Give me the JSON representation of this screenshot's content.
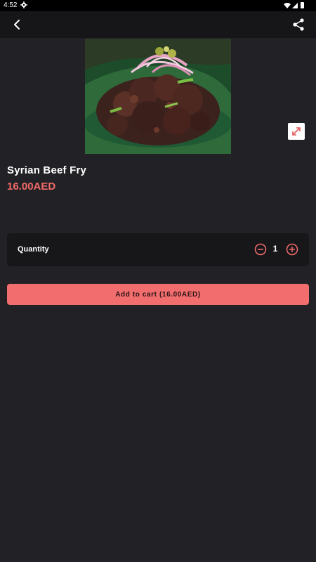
{
  "status_bar": {
    "time": "4:52",
    "icons": [
      "settings-gear-icon",
      "wifi-icon",
      "signal-icon",
      "battery-icon"
    ]
  },
  "app_bar": {
    "back_icon": "chevron-left-icon",
    "share_icon": "share-icon"
  },
  "product": {
    "image_icon": "food-photo",
    "expand_icon": "expand-arrows-icon",
    "name": "Syrian Beef Fry",
    "price": "16.00AED"
  },
  "quantity": {
    "label": "Quantity",
    "value": "1",
    "minus_icon": "minus-circle-icon",
    "plus_icon": "plus-circle-icon"
  },
  "cart": {
    "button_label": "Add to cart (16.00AED)"
  },
  "colors": {
    "background": "#222226",
    "app_bar": "#161619",
    "card": "#17171a",
    "accent": "#f26d6d",
    "price": "#f36a6a",
    "status_bar": "#000000"
  }
}
